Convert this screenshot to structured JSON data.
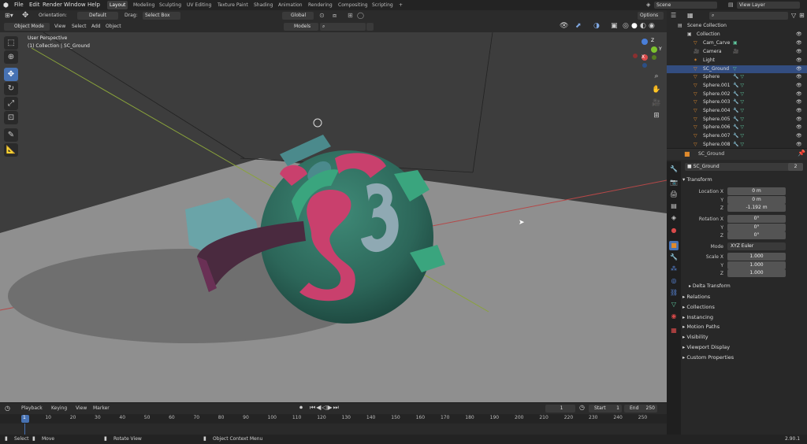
{
  "topbar": {
    "menus": [
      "File",
      "Edit",
      "Render",
      "Window",
      "Help"
    ],
    "workspaces": [
      "Layout",
      "Modeling",
      "Sculpting",
      "UV Editing",
      "Texture Paint",
      "Shading",
      "Animation",
      "Rendering",
      "Compositing",
      "Scripting"
    ],
    "add_tab": "+",
    "scene": "Scene",
    "view_layer": "View Layer"
  },
  "toolbar": {
    "orientation_label": "Orientation:",
    "orientation_value": "Default",
    "drag_label": "Drag:",
    "drag_value": "Select Box",
    "transform_orientation": "Global",
    "options": "Options"
  },
  "header2": {
    "mode": "Object Mode",
    "menus": [
      "View",
      "Select",
      "Add",
      "Object"
    ],
    "models": "Models"
  },
  "viewport": {
    "view_name": "User Perspective",
    "collection_info": "(1) Collection | SC_Ground",
    "gizmo": {
      "x": "X",
      "y": "Y",
      "z": "Z"
    }
  },
  "outliner": {
    "root": "Scene Collection",
    "collection": "Collection",
    "items": [
      "Cam_Carve",
      "Camera",
      "Light",
      "SC_Ground",
      "Sphere",
      "Sphere.001",
      "Sphere.002",
      "Sphere.003",
      "Sphere.004",
      "Sphere.005",
      "Sphere.006",
      "Sphere.007",
      "Sphere.008"
    ]
  },
  "properties": {
    "object_name": "SC_Ground",
    "object_field": "SC_Ground",
    "users": "2",
    "transform_title": "Transform",
    "location_label": "Location X",
    "rotation_label": "Rotation X",
    "scale_label": "Scale X",
    "y": "Y",
    "z": "Z",
    "location": [
      "0 m",
      "0 m",
      "-1.192 m"
    ],
    "rotation": [
      "0°",
      "0°",
      "0°"
    ],
    "mode_label": "Mode",
    "mode_value": "XYZ Euler",
    "scale": [
      "1.000",
      "1.000",
      "1.000"
    ],
    "delta": "Delta Transform",
    "panels": [
      "Relations",
      "Collections",
      "Instancing",
      "Motion Paths",
      "Visibility",
      "Viewport Display",
      "Custom Properties"
    ]
  },
  "timeline": {
    "menus": [
      "Playback",
      "Keying",
      "View",
      "Marker"
    ],
    "current_frame": "1",
    "start_label": "Start",
    "start": "1",
    "end_label": "End",
    "end": "250",
    "ticks": [
      "1",
      "10",
      "20",
      "30",
      "40",
      "50",
      "60",
      "70",
      "80",
      "90",
      "100",
      "110",
      "120",
      "130",
      "140",
      "150",
      "160",
      "170",
      "180",
      "190",
      "200",
      "210",
      "220",
      "230",
      "240",
      "250"
    ]
  },
  "statusbar": {
    "select": "Select",
    "move": "Move",
    "rotate": "Rotate View",
    "context": "Object Context Menu",
    "version": "2.90.1"
  },
  "colors": {
    "accent": "#4772b3",
    "selected_row": "#334d80",
    "sphere": "#2f6b5e",
    "pink": "#c9406d",
    "teal": "#4b8a8c",
    "ground": "#8c8c8c",
    "orange_icon": "#e08a2c",
    "green_icon": "#5fc9a0"
  }
}
